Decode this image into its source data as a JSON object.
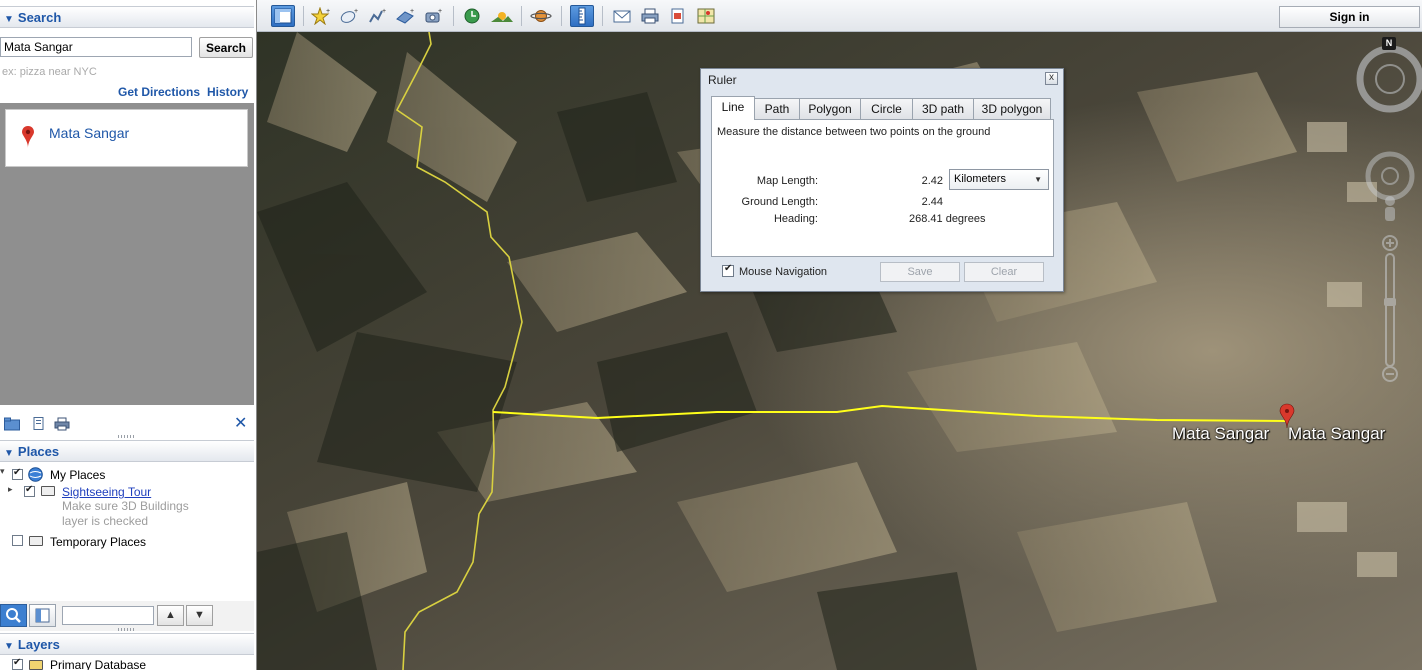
{
  "search": {
    "header": "Search",
    "query": "Mata Sangar",
    "button_label": "Search",
    "hint": "ex: pizza near NYC",
    "get_directions": "Get Directions",
    "history": "History",
    "results": [
      {
        "title": "Mata Sangar"
      }
    ]
  },
  "places": {
    "header": "Places",
    "my_places": "My Places",
    "sightseeing_tour": "Sightseeing Tour",
    "tour_note": "Make sure 3D Buildings\nlayer is checked",
    "temporary_places": "Temporary Places"
  },
  "layers": {
    "header": "Layers",
    "primary_database": "Primary Database"
  },
  "toolbar": {
    "sign_in": "Sign in"
  },
  "ruler": {
    "title": "Ruler",
    "close": "x",
    "tabs": [
      "Line",
      "Path",
      "Polygon",
      "Circle",
      "3D path",
      "3D polygon"
    ],
    "active_tab": "Line",
    "description": "Measure the distance between two points on the ground",
    "map_length_label": "Map Length:",
    "map_length_value": "2.42",
    "unit": "Kilometers",
    "ground_length_label": "Ground Length:",
    "ground_length_value": "2.44",
    "heading_label": "Heading:",
    "heading_value": "268.41 degrees",
    "mouse_navigation": "Mouse Navigation",
    "save": "Save",
    "clear": "Clear"
  },
  "map": {
    "placemark_labels": [
      "Mata Sangar",
      "Mata Sangar"
    ],
    "compass_north": "N",
    "ruler_line_color": "#ffff1a",
    "border_line_color": "#d8d040"
  },
  "colors": {
    "accent": "#1f57a8",
    "pin": "#d9382c"
  }
}
